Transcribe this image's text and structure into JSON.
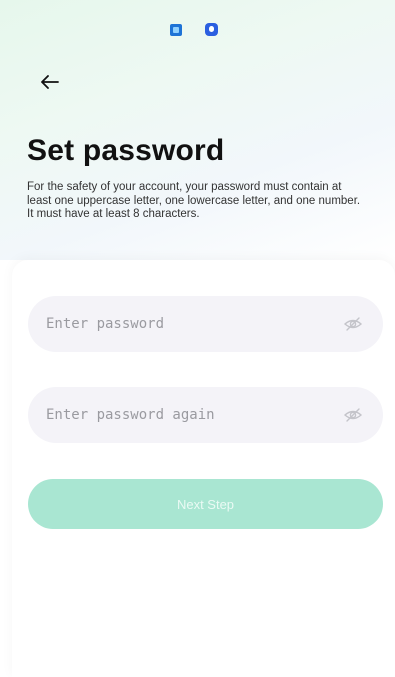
{
  "status_bar": {
    "left_text": "",
    "right_text": ""
  },
  "header": {
    "back_icon": "arrow-left-icon"
  },
  "page": {
    "title": "Set password",
    "description": "For the safety of your account, your password must contain at least one uppercase letter, one lowercase letter, and one number. It must have at least 8 characters."
  },
  "form": {
    "password_placeholder": "Enter password",
    "password_value": "",
    "confirm_placeholder": "Enter password again",
    "confirm_value": "",
    "eye_icon": "eye-off-icon",
    "next_label": "Next Step"
  },
  "colors": {
    "accent": "#a9e6d2",
    "input_bg": "#f4f3f8",
    "title": "#111111"
  }
}
